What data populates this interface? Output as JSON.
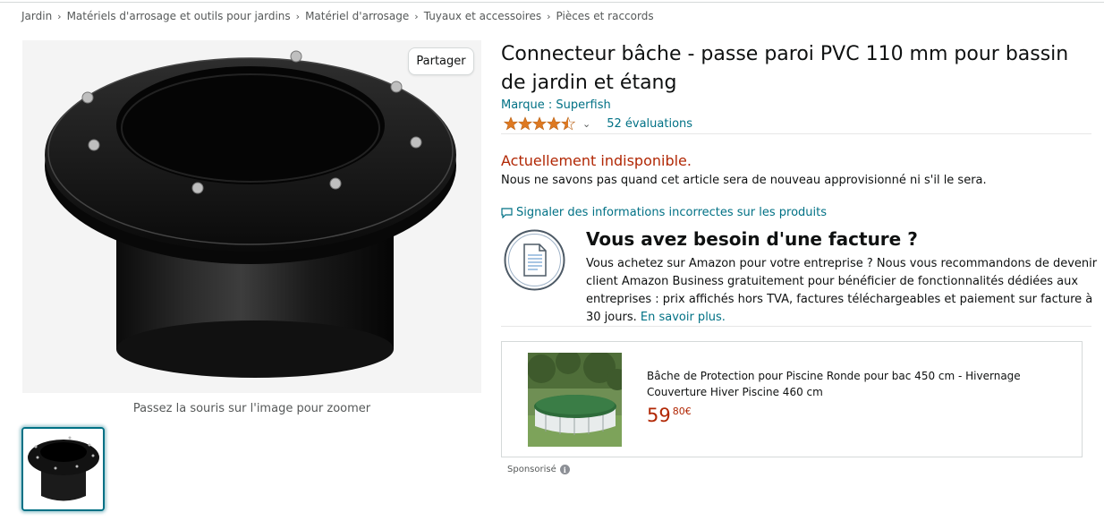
{
  "breadcrumb": [
    "Jardin",
    "Matériels d'arrosage et outils pour jardins",
    "Matériel d'arrosage",
    "Tuyaux et accessoires",
    "Pièces et raccords"
  ],
  "breadcrumb_separator": "›",
  "gallery": {
    "share_label": "Partager",
    "zoom_hint": "Passez la souris sur l'image pour zoomer"
  },
  "product": {
    "title": "Connecteur bâche - passe paroi PVC 110 mm pour bassin de jardin et étang",
    "brand": "Marque : Superfish",
    "rating_stars": 4.5,
    "rating_count": "52 évaluations",
    "availability": "Actuellement indisponible.",
    "availability_note": "Nous ne savons pas quand cet article sera de nouveau approvisionné ni s'il le sera.",
    "report_link": "Signaler des informations incorrectes sur les produits"
  },
  "invoice": {
    "title": "Vous avez besoin d'une facture ?",
    "body": "Vous achetez sur Amazon pour votre entreprise ? Nous vous recommandons de devenir client Amazon Business gratuitement pour bénéficier de fonctionnalités dédiées aux entreprises : prix affichés hors TVA, factures téléchargeables et paiement sur facture à 30 jours.",
    "link": "En savoir plus."
  },
  "sponsored_ad": {
    "title": "Bâche de Protection pour Piscine Ronde pour bac 450 cm - Hivernage Couverture Hiver Piscine 460 cm",
    "price_whole": "59",
    "price_fraction": "80",
    "currency": "€",
    "sponsored_label": "Sponsorisé"
  },
  "colors": {
    "link": "#007185",
    "price": "#b12704",
    "star": "#de7921",
    "text": "#0f1111"
  },
  "icons": [
    "share-button",
    "star-icon",
    "chevron-down-icon",
    "speech-bubble-icon",
    "document-icon",
    "info-icon"
  ]
}
